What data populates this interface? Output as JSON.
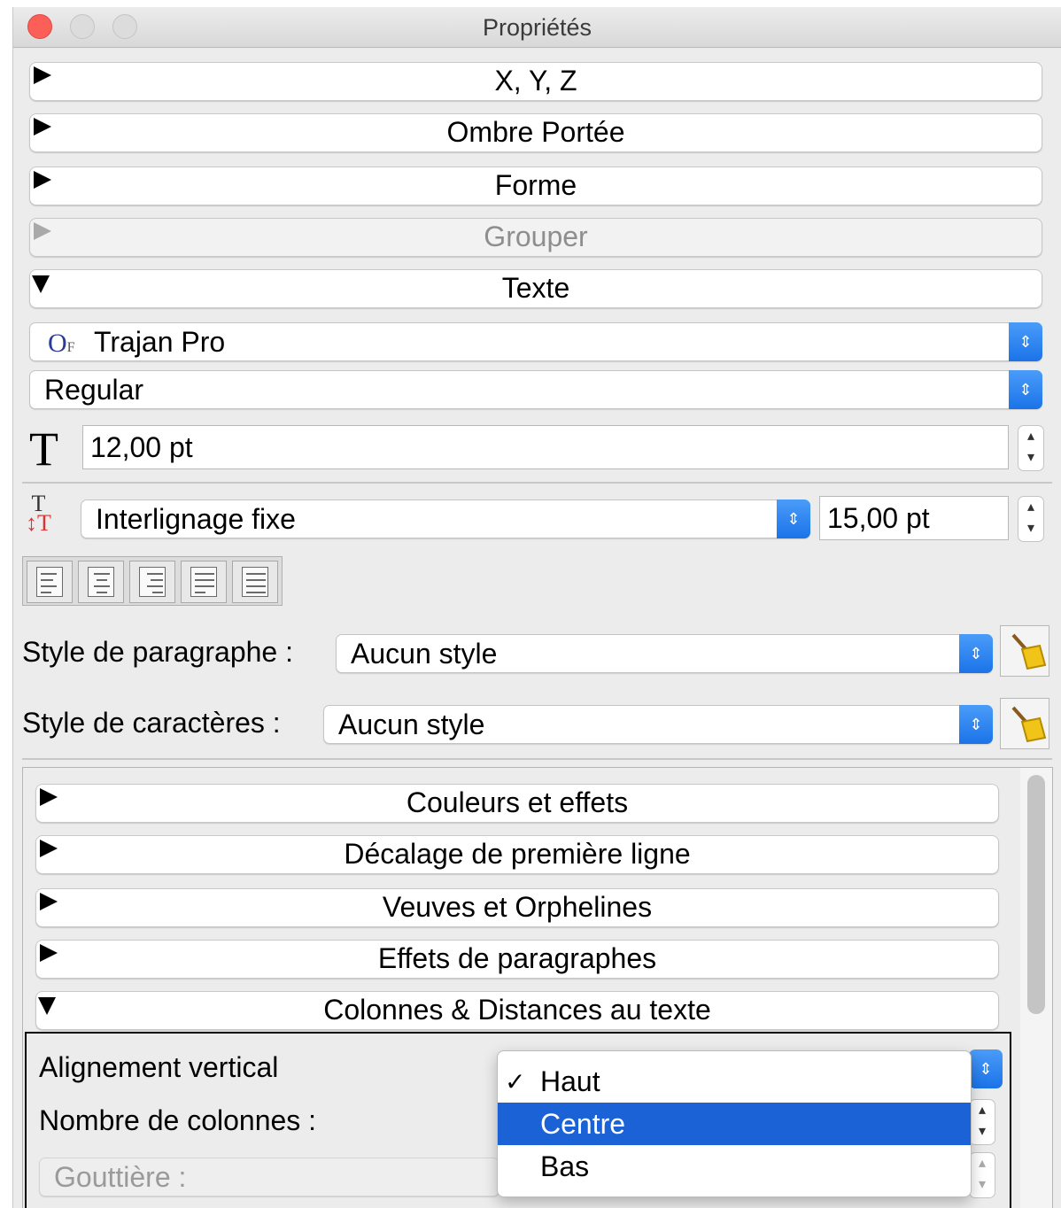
{
  "window": {
    "title": "Propriétés"
  },
  "sections": {
    "xyz": "X, Y, Z",
    "shadow": "Ombre Portée",
    "shape": "Forme",
    "group": "Grouper",
    "text": "Texte"
  },
  "text_panel": {
    "font_family": "Trajan Pro",
    "font_family_icon": "opentype-font-icon",
    "font_style": "Regular",
    "font_size": "12,00 pt",
    "line_spacing_mode": "Interlignage fixe",
    "line_spacing_value": "15,00 pt",
    "alignment_buttons": [
      "align-left",
      "align-center",
      "align-right",
      "align-justify",
      "align-force-justify"
    ],
    "paragraph_style_label": "Style de paragraphe :",
    "paragraph_style_value": "Aucun style",
    "character_style_label": "Style de caractères :",
    "character_style_value": "Aucun style"
  },
  "sub_sections": {
    "colors": "Couleurs et effets",
    "first_line": "Décalage de première ligne",
    "widows": "Veuves et Orphelines",
    "para_effects": "Effets de paragraphes",
    "columns": "Colonnes & Distances au texte"
  },
  "columns_panel": {
    "vertical_alignment_label": "Alignement vertical",
    "columns_count_label": "Nombre de colonnes :",
    "gutter_label": "Gouttière :"
  },
  "vertical_alignment_menu": {
    "items": [
      "Haut",
      "Centre",
      "Bas"
    ],
    "checked": "Haut",
    "highlighted": "Centre",
    "check_mark": "✓"
  },
  "colors": {
    "accent": "#1a62d6",
    "close": "#fc5f57"
  }
}
